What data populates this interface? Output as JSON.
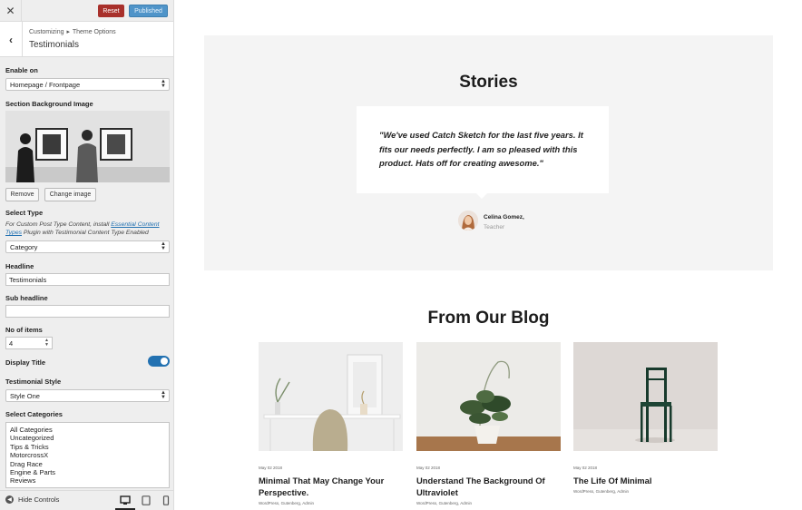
{
  "topbar": {
    "close_glyph": "✕",
    "reset_label": "Reset",
    "published_label": "Published"
  },
  "section": {
    "back_glyph": "‹",
    "breadcrumb_root": "Customizing",
    "breadcrumb_sep": "▸",
    "breadcrumb_panel": "Theme Options",
    "title": "Testimonials"
  },
  "controls": {
    "enable_on_label": "Enable on",
    "enable_on_value": "Homepage / Frontpage",
    "bg_image_label": "Section Background Image",
    "remove_label": "Remove",
    "change_image_label": "Change image",
    "select_type_label": "Select Type",
    "desc_prefix": "For Custom Post Type Content, install ",
    "desc_link": "Essential Content Types",
    "desc_suffix": " Plugin with Testimonial Content Type Enabled",
    "select_type_value": "Category",
    "headline_label": "Headline",
    "headline_value": "Testimonials",
    "subheadline_label": "Sub headline",
    "subheadline_value": "",
    "items_label": "No of items",
    "items_value": "4",
    "display_title_label": "Display Title",
    "display_title_on": true,
    "style_label": "Testimonial Style",
    "style_value": "Style One",
    "categories_label": "Select Categories",
    "categories": [
      "All Categories",
      "Uncategorized",
      "Tips & Tricks",
      "MotorcrossX",
      "Drag Race",
      "Engine & Parts",
      "Reviews"
    ]
  },
  "footer": {
    "hide_controls_label": "Hide Controls",
    "devices": [
      "desktop-icon",
      "tablet-icon",
      "mobile-icon"
    ]
  },
  "preview": {
    "stories_title": "Stories",
    "quote": "\"We've used Catch Sketch for the last five years. It fits our needs perfectly. I am so pleased with this product. Hats off for creating awesome.\"",
    "author_name": "Celina Gomez,",
    "author_role": "Teacher",
    "blog_title": "From Our Blog",
    "posts": [
      {
        "date": "May 02 2018",
        "title": "Minimal That May Change Your Perspective.",
        "meta": "WordPress, Gutenberg, Admin"
      },
      {
        "date": "May 02 2018",
        "title": "Understand The Background Of Ultraviolet",
        "meta": "WordPress, Gutenberg, Admin"
      },
      {
        "date": "May 02 2018",
        "title": "The Life Of Minimal",
        "meta": "WordPress, Gutenberg, Admin"
      }
    ]
  },
  "colors": {
    "reset": "#a8302b",
    "published": "#4f94c9",
    "toggle": "#2271b1",
    "stories_bg": "#f4f4f4"
  }
}
